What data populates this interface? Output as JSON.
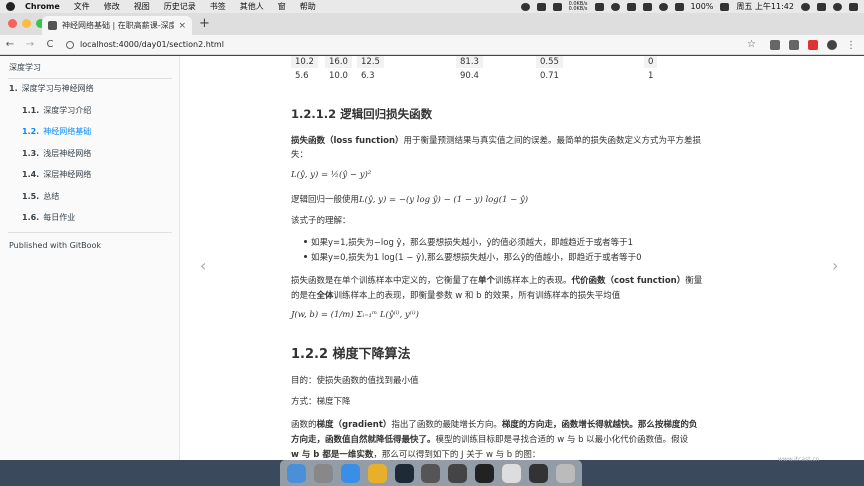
{
  "menubar": {
    "items": [
      "Chrome",
      "文件",
      "修改",
      "视图",
      "历史记录",
      "书签",
      "其他人",
      "窗",
      "帮助"
    ],
    "net_up": "0.0KB/s",
    "net_down": "0.0KB/s",
    "battery": "100%",
    "clock": "周五 上午11:42"
  },
  "tab": {
    "title": "神经网络基础 | 在职高薪课-深度...",
    "close": "×",
    "new_tab": "+"
  },
  "toolbar": {
    "back": "←",
    "forward": "→",
    "reload": "C",
    "url": "localhost:4000/day01/section2.html",
    "star": "☆"
  },
  "sidebar": {
    "root": "深度学习",
    "chapter": {
      "num": "1.",
      "label": "深度学习与神经网络"
    },
    "items": [
      {
        "num": "1.1.",
        "label": "深度学习介绍"
      },
      {
        "num": "1.2.",
        "label": "神经网络基础"
      },
      {
        "num": "1.3.",
        "label": "浅层神经网络"
      },
      {
        "num": "1.4.",
        "label": "深层神经网络"
      },
      {
        "num": "1.5.",
        "label": "总结"
      },
      {
        "num": "1.6.",
        "label": "每日作业"
      }
    ],
    "published": "Published with GitBook"
  },
  "content": {
    "table_rows": [
      [
        "10.2",
        "16.0",
        "12.5",
        "81.3",
        "0.55",
        "0"
      ],
      [
        "5.6",
        "10.0",
        "6.3",
        "90.4",
        "0.71",
        "1"
      ]
    ],
    "h_loss": "1.2.1.2 逻辑回归损失函数",
    "p1_bold": "损失函数（loss function）",
    "p1_rest": "用于衡量预测结果与真实值之间的误差。最简单的损失函数定义方式为平方差损",
    "p1_line2": "失：",
    "formula1": "L(ŷ, y) = ½(ŷ − y)²",
    "p2_prefix": "逻辑回归一般使用",
    "formula2": "L(ŷ, y) = −(y log ŷ) − (1 − y) log(1 − ŷ)",
    "p3": "该式子的理解：",
    "li1": "如果y=1,损失为−log ŷ，那么要想损失越小，ŷ的值必须越大，即越趋近于或者等于1",
    "li2": "如果y=0,损失为1 log(1 − ŷ),那么要想损失越小，那么ŷ的值越小，即趋近于或者等于0",
    "p4_a": "损失函数是在单个训练样本中定义的，它衡量了在",
    "p4_b": "单个",
    "p4_c": "训练样本上的表现。",
    "p4_d": "代价函数（cost function）",
    "p4_e": "衡量",
    "p4_line2a": "的是在",
    "p4_line2b": "全体",
    "p4_line2c": "训练样本上的表现，即衡量参数 w 和 b 的效果，所有训练样本的损失平均值",
    "formula3": "J(w, b) = (1/m) Σᵢ₌₁ᵐ L(ŷ⁽ⁱ⁾, y⁽ⁱ⁾)",
    "h_gd": "1.2.2 梯度下降算法",
    "goal": "目的：使损失函数的值找到最小值",
    "method": "方式：梯度下降",
    "p5_a": "函数的",
    "p5_b": "梯度（gradient）",
    "p5_c": "指出了函数的最陡增长方向。",
    "p5_d": "梯度的方向走，函数增长得就越快。那么按梯度的负",
    "p5_line2a": "方向走，函数值自然就降低得最快了。",
    "p5_line2b": "模型的训练目标即是寻找合适的 w 与 b 以最小化代价函数值。假设",
    "p5_line3a": "w 与 b 都是一维实数",
    "p5_line3b": "，那么可以得到如下的 J 关于 w 与 b 的图："
  },
  "nav": {
    "prev": "‹",
    "next": "›"
  },
  "watermark": "www.itcast.cn"
}
